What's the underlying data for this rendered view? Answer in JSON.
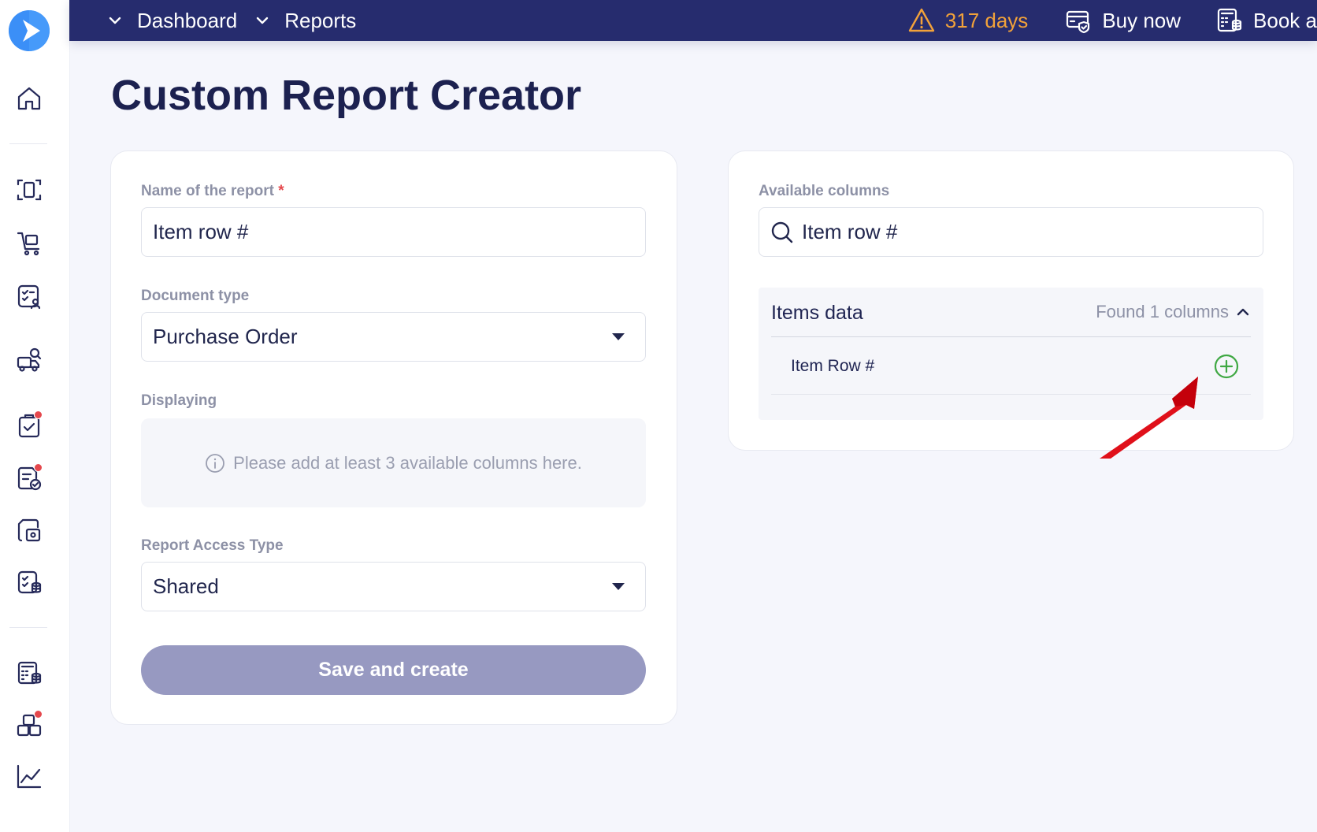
{
  "topbar": {
    "nav": [
      {
        "label": "Dashboard"
      },
      {
        "label": "Reports"
      }
    ],
    "trial": {
      "label": "317 days"
    },
    "buy": {
      "label": "Buy now"
    },
    "book": {
      "label": "Book a"
    }
  },
  "page": {
    "title": "Custom Report Creator"
  },
  "form": {
    "name_label": "Name of the report",
    "required_mark": "*",
    "name_value": "Item row #",
    "doctype_label": "Document type",
    "doctype_value": "Purchase Order",
    "displaying_label": "Displaying",
    "displaying_hint": "Please add at least 3 available columns here.",
    "access_label": "Report Access Type",
    "access_value": "Shared",
    "save_label": "Save and create"
  },
  "columns": {
    "label": "Available columns",
    "search_value": "Item row #",
    "group_title": "Items data",
    "group_count": "Found 1 columns",
    "items": [
      {
        "label": "Item Row #"
      }
    ]
  },
  "colors": {
    "topbar": "#262c6e",
    "accent_warning": "#f2a23a",
    "add_green": "#3fa843",
    "annotation_arrow": "#e0101a",
    "button_disabled": "#9799c1"
  }
}
